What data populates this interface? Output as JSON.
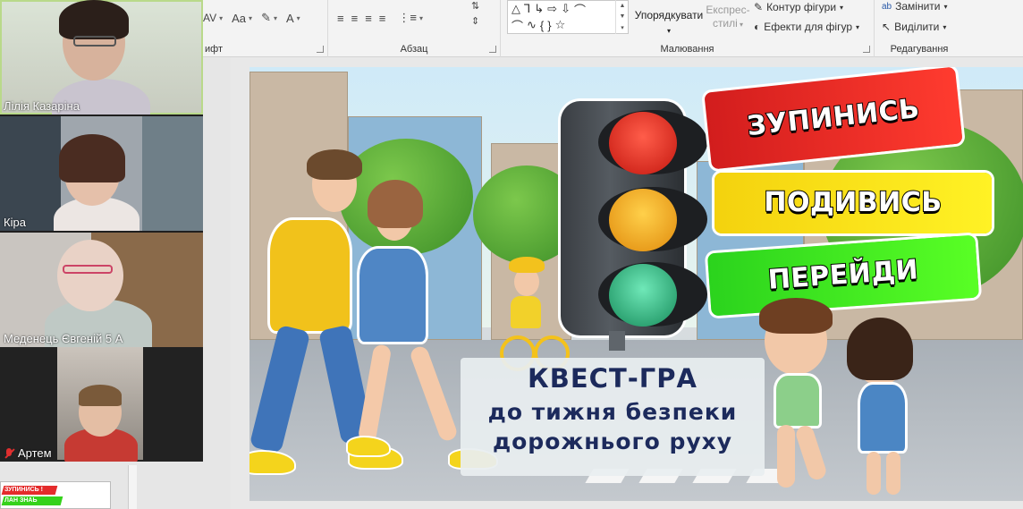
{
  "ribbon": {
    "font_group_label": "ифт",
    "paragraph_group_label": "Абзац",
    "drawing_group_label": "Малювання",
    "editing_group_label": "Редагування",
    "arrange_label": "Упорядкувати",
    "quick_styles_label_1": "Експрес-",
    "quick_styles_label_2": "стилі",
    "shape_outline_label": "Контур фігури",
    "shape_effects_label": "Ефекти для фігур",
    "replace_label": "Замінити",
    "select_label": "Виділити"
  },
  "participants": [
    {
      "name": "Лілія Казаріна",
      "active": true,
      "muted": false
    },
    {
      "name": "Кіра",
      "active": false,
      "muted": false
    },
    {
      "name": "Меденець Євгеній 5 А",
      "active": false,
      "muted": false
    },
    {
      "name": "Артем",
      "active": false,
      "muted": true
    }
  ],
  "thumbnail": {
    "line1": "ЗУПИНИСЬ !",
    "line2": "ЛАН ЗНАЬ"
  },
  "slide": {
    "banner_stop": "ЗУПИНИСЬ",
    "banner_look": "ПОДИВИСЬ",
    "banner_go": "ПЕРЕЙДИ",
    "title_line1": "КВЕСТ-ГРА",
    "title_line2": "до тижня безпеки",
    "title_line3": "дорожнього руху"
  },
  "colors": {
    "stop": "#e52222",
    "look": "#fbe51a",
    "go": "#3ee01e",
    "title_text": "#1c2a5c",
    "active_speaker": "#b9d98a"
  }
}
